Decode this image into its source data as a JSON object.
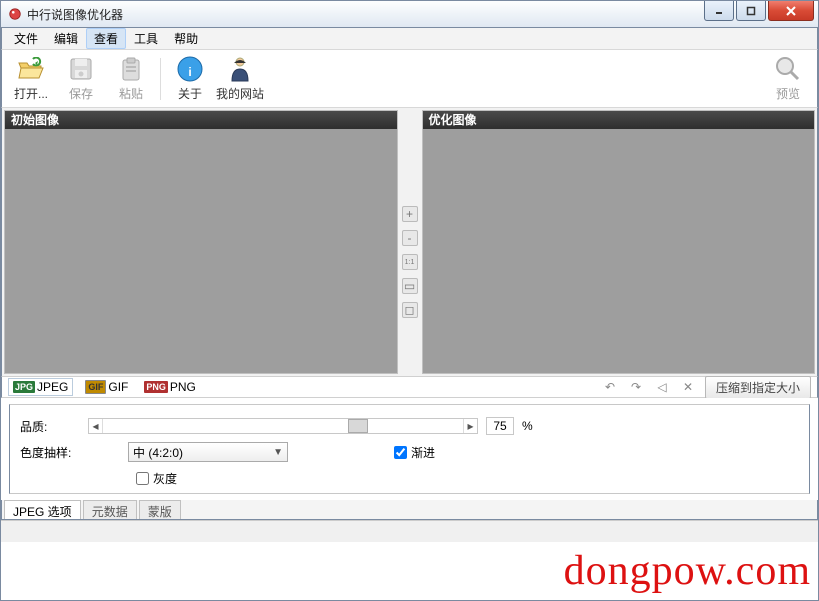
{
  "window": {
    "title": "中行说图像优化器"
  },
  "menu": {
    "file": "文件",
    "edit": "编辑",
    "view": "查看",
    "tools": "工具",
    "help": "帮助"
  },
  "toolbar": {
    "open": "打开...",
    "save": "保存",
    "paste": "粘贴",
    "about": "关于",
    "mysite": "我的网站",
    "preview": "预览"
  },
  "panels": {
    "original": "初始图像",
    "optimized": "优化图像"
  },
  "midtools": {
    "zoom_in": "+",
    "zoom_out": "-",
    "one_to_one": "1:1",
    "fit": "▭",
    "screen": "◻"
  },
  "formats": {
    "jpeg": "JPEG",
    "gif": "GIF",
    "png": "PNG"
  },
  "actions": {
    "compress_to_size": "压缩到指定大小"
  },
  "settings": {
    "quality_label": "品质:",
    "quality_value": "75",
    "quality_unit": "%",
    "chroma_label": "色度抽样:",
    "chroma_value": "中 (4:2:0)",
    "progressive": "渐进",
    "grayscale": "灰度"
  },
  "bottom_tabs": {
    "jpeg_options": "JPEG 选项",
    "metadata": "元数据",
    "mask": "蒙版"
  },
  "watermark": "dongpow.com"
}
